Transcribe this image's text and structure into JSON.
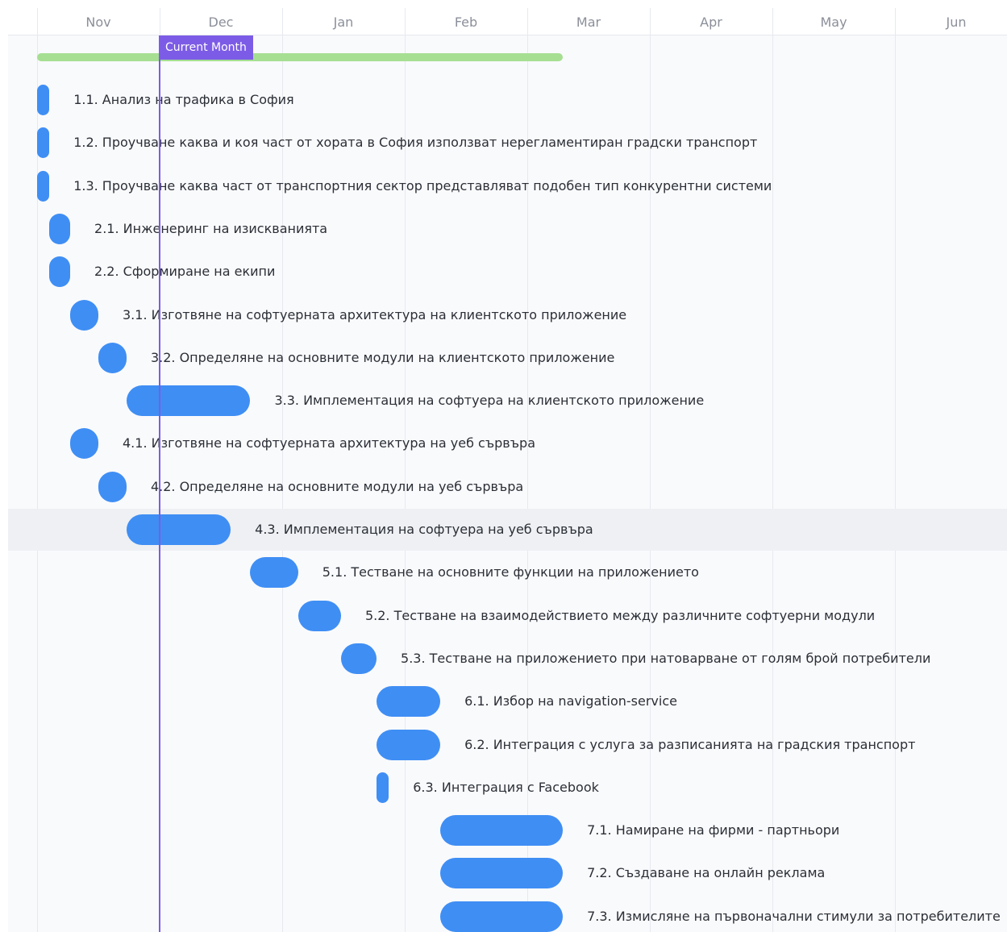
{
  "timeline": {
    "months": [
      {
        "label": "Nov",
        "start": 0
      },
      {
        "label": "Dec",
        "start": 1
      },
      {
        "label": "Jan",
        "start": 2
      },
      {
        "label": "Feb",
        "start": 3
      },
      {
        "label": "Mar",
        "start": 4
      },
      {
        "label": "Apr",
        "start": 5
      },
      {
        "label": "May",
        "start": 6
      },
      {
        "label": "Jun",
        "start": 7
      }
    ],
    "current_month": {
      "label": "Current Month",
      "at": 1.0
    }
  },
  "summary": {
    "start": 0.0,
    "end": 4.29,
    "color": "#a6df92"
  },
  "selected_row": 10,
  "tasks": [
    {
      "label": "1.1. Анализ на трафика в София",
      "start": 0.0,
      "end": 0.1
    },
    {
      "label": "1.2. Проучване каква и коя част от хората в София използват нерегламентиран градски транспорт",
      "start": 0.0,
      "end": 0.1
    },
    {
      "label": "1.3. Проучване каква част от транспортния сектор представляват подобен тип конкурентни системи",
      "start": 0.0,
      "end": 0.1
    },
    {
      "label": "2.1. Инженеринг на изискванията",
      "start": 0.1,
      "end": 0.27
    },
    {
      "label": "2.2. Сформиране на екипи",
      "start": 0.1,
      "end": 0.27
    },
    {
      "label": "3.1. Изготвяне на софтуерната архитектура на клиентското приложение",
      "start": 0.27,
      "end": 0.5
    },
    {
      "label": "3.2. Определяне на основните модули на клиентското приложение",
      "start": 0.5,
      "end": 0.73
    },
    {
      "label": "3.3. Имплементация на софтуера на клиентското приложение",
      "start": 0.73,
      "end": 1.74
    },
    {
      "label": "4.1. Изготвяне на софтуерната архитектура на уеб сървъра",
      "start": 0.27,
      "end": 0.5
    },
    {
      "label": "4.2. Определяне на основните модули на уеб сървъра",
      "start": 0.5,
      "end": 0.73
    },
    {
      "label": "4.3. Имплементация на софтуера на уеб сървъра",
      "start": 0.73,
      "end": 1.58
    },
    {
      "label": "5.1. Тестване на основните функции на приложението",
      "start": 1.74,
      "end": 2.13
    },
    {
      "label": "5.2. Тестване на взаимодействието между различните софтуерни модули",
      "start": 2.13,
      "end": 2.48
    },
    {
      "label": "5.3. Тестване на приложението при натоварване от голям брой потребители",
      "start": 2.48,
      "end": 2.77
    },
    {
      "label": "6.1. Избор на navigation-service",
      "start": 2.77,
      "end": 3.29
    },
    {
      "label": "6.2. Интеграция с услуга за разписанията на градския транспорт",
      "start": 2.77,
      "end": 3.29
    },
    {
      "label": "6.3. Интеграция с Facebook",
      "start": 2.77,
      "end": 2.87
    },
    {
      "label": "7.1. Намиране на фирми - партньори",
      "start": 3.29,
      "end": 4.29
    },
    {
      "label": "7.2. Създаване на онлайн реклама",
      "start": 3.29,
      "end": 4.29
    },
    {
      "label": "7.3. Измисляне на първоначални стимули за потребителите",
      "start": 3.29,
      "end": 4.29
    }
  ],
  "colors": {
    "task": "#3f8ef4",
    "current_month": "#7c5ce6",
    "grid": "#e7e9ef",
    "month_text": "#8b8f99",
    "task_text": "#2b2f36"
  }
}
